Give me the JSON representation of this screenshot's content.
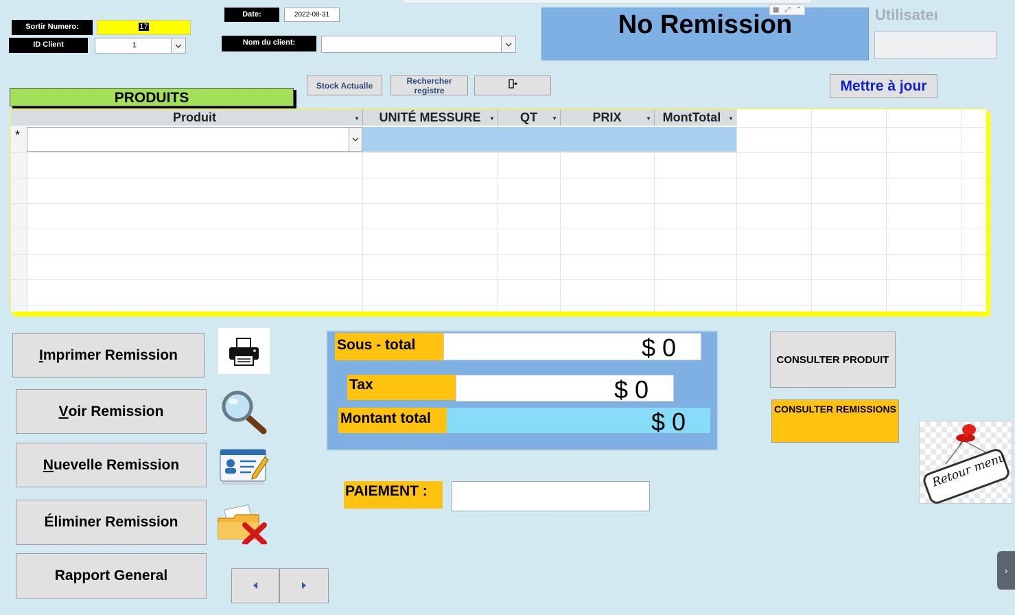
{
  "header": {
    "sortir_numero_label": "Sortir Numero:",
    "sortir_numero_value": "17",
    "id_client_label": "ID Client",
    "id_client_value": "1",
    "date_label": "Date:",
    "date_value": "2022-08-31",
    "nom_client_label": "Nom du client:",
    "nom_client_value": "",
    "title": "No Remission",
    "utilisateur_label": "Utilisateı",
    "utilisateur_value": ""
  },
  "toolbar": {
    "stock_label": "Stock Actualle",
    "rechercher_label": "Rechercher registre",
    "exit_icon": "exit-door-icon",
    "mettre_a_jour_label": "Mettre à jour"
  },
  "products": {
    "section_label": "PRODUITS",
    "columns": [
      "Produit",
      "UNITÉ MESSURE",
      "QT",
      "PRIX",
      "MontTotal"
    ],
    "new_row_marker": "*"
  },
  "actions": {
    "imprimer": "Imprimer Remission",
    "voir": "Voir Remission",
    "nouvelle": "Nuevelle Remission",
    "eliminer": "Éliminer Remission",
    "rapport": "Rapport General"
  },
  "icons": {
    "printer": "printer-icon",
    "search": "magnifier-icon",
    "new": "id-card-edit-icon",
    "delete": "folder-delete-icon",
    "prev": "left-arrow-icon",
    "next": "right-arrow-icon",
    "pin": "push-pin-icon"
  },
  "totals": {
    "sous_total_label": "Sous - total",
    "sous_total_value": "$ 0",
    "tax_label": "Tax",
    "tax_value": "$ 0",
    "montant_label": "Montant total",
    "montant_value": "$ 0"
  },
  "paiement": {
    "label": "PAIEMENT :",
    "value": ""
  },
  "side": {
    "consulter_produit": "CONSULTER PRODUIT",
    "consulter_remissions": "CONSULTER REMISSIONS",
    "retour_menu": "Retour menu"
  },
  "colors": {
    "background": "#d2e9f1",
    "title_bg": "#7fb0e3",
    "highlight_yellow": "#ffff00",
    "orange": "#ffc20e",
    "produits_green": "#a3e05a",
    "row_blue": "#a8d1f0",
    "montant_cyan": "#87dcf8",
    "link_blue": "#0f22c9"
  }
}
